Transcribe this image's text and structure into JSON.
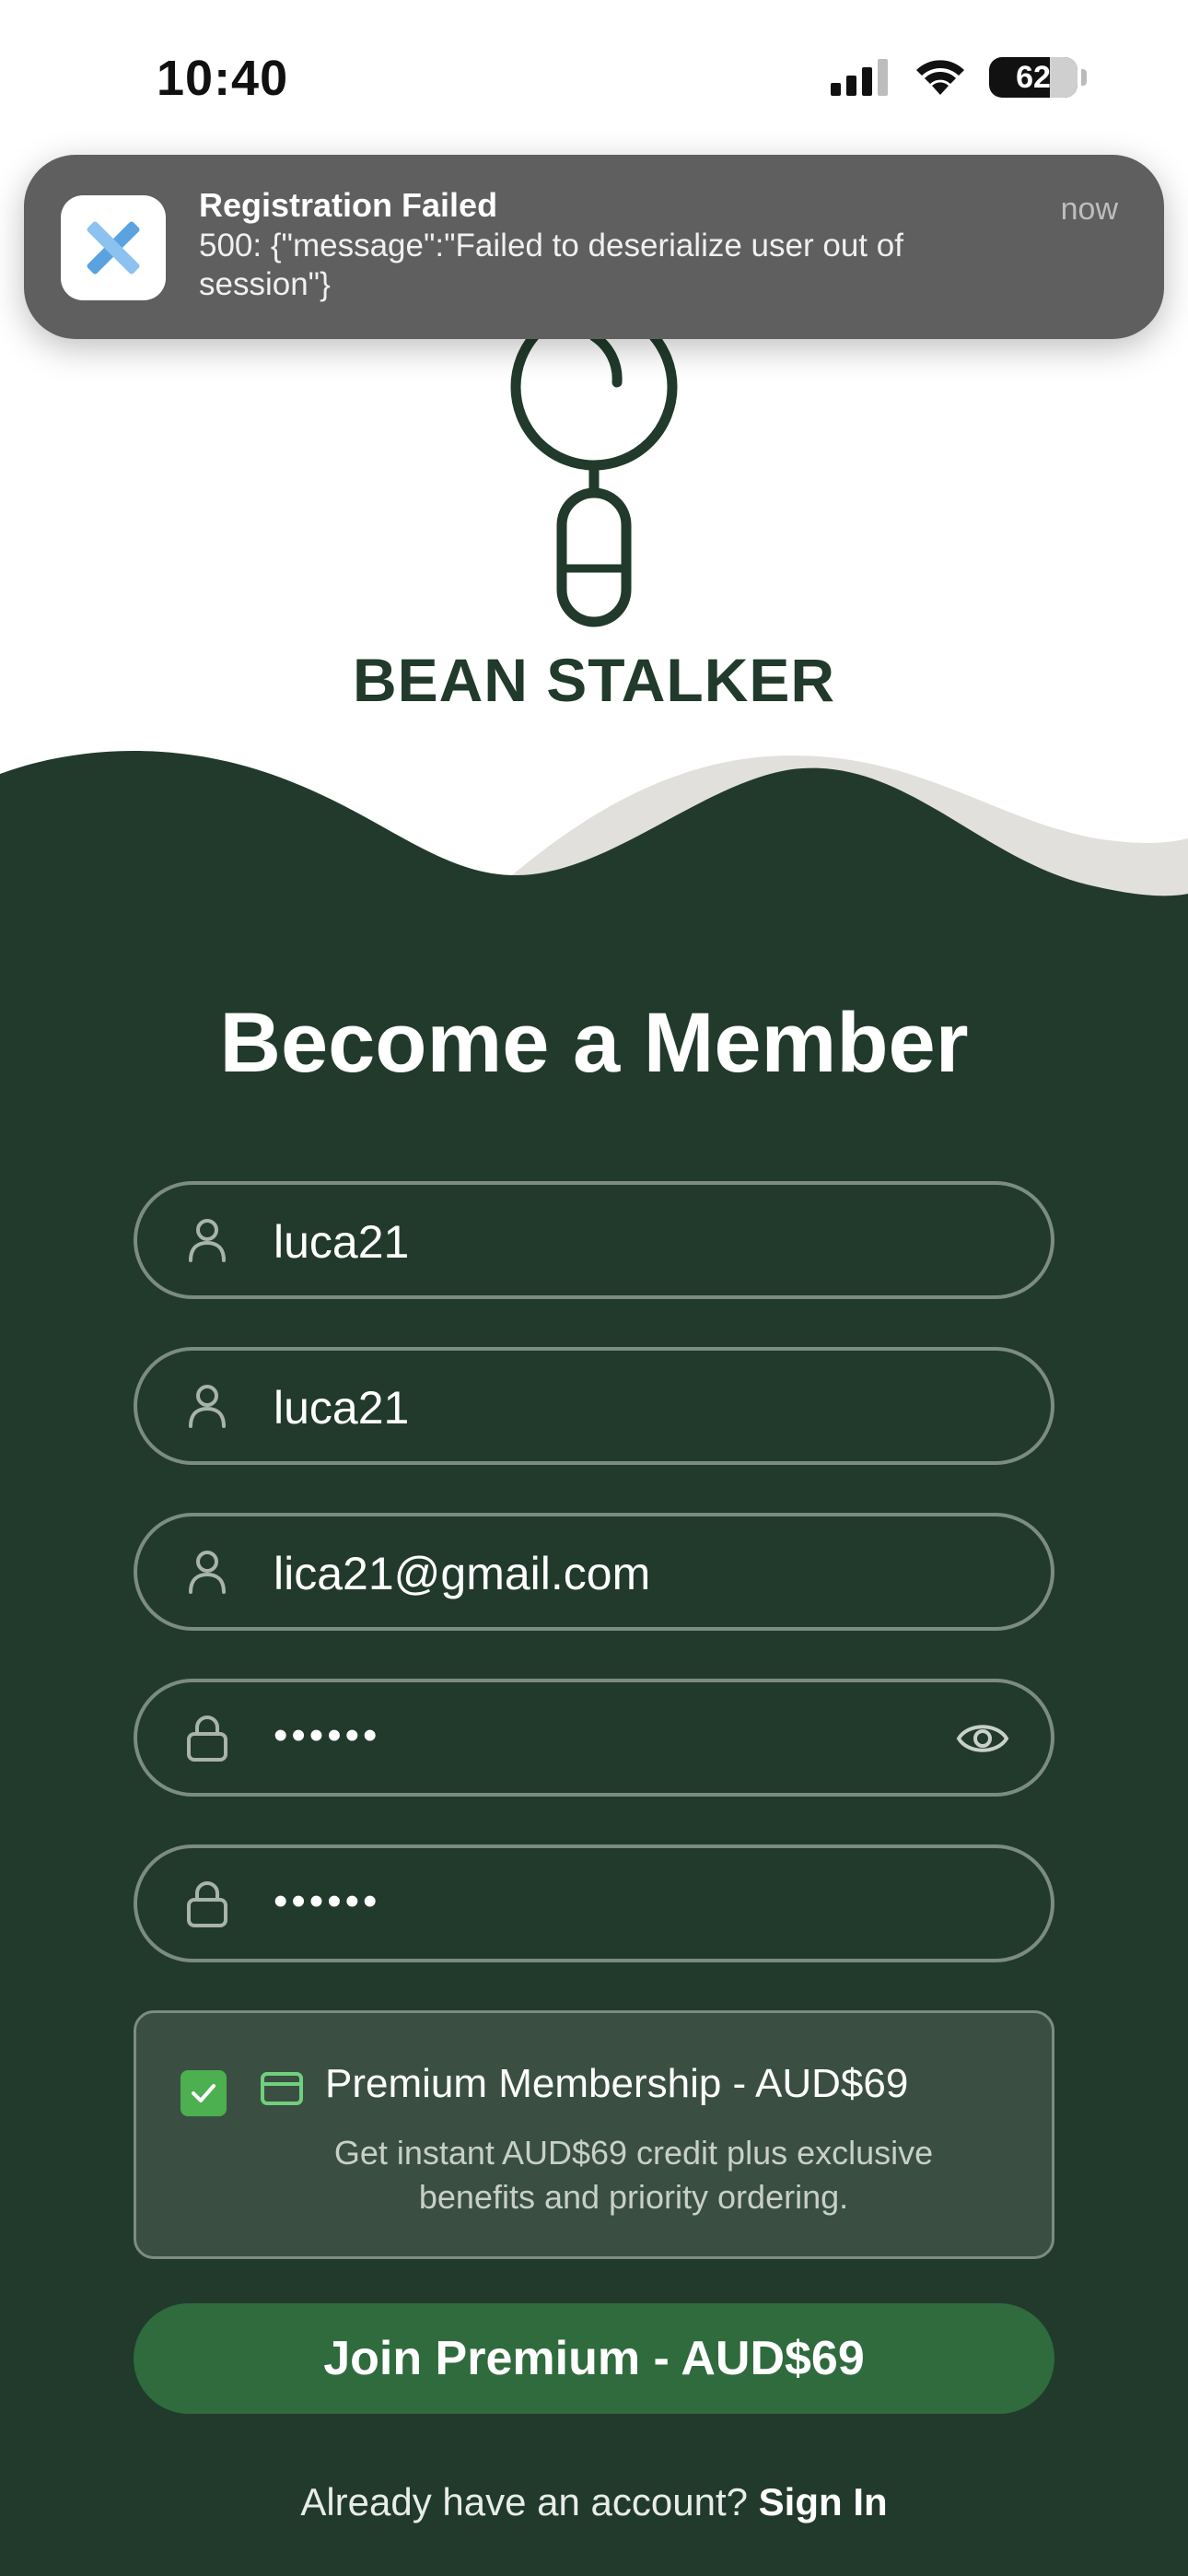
{
  "status_bar": {
    "time": "10:40",
    "battery": "62"
  },
  "notification": {
    "title": "Registration Failed",
    "body": "500: {\"message\":\"Failed to deserialize user out of session\"}",
    "time": "now"
  },
  "brand": {
    "name": "BEAN STALKER"
  },
  "form": {
    "heading": "Become a Member",
    "fields": [
      {
        "value": "luca21",
        "icon": "person-icon"
      },
      {
        "value": "luca21",
        "icon": "person-icon"
      },
      {
        "value": "lica21@gmail.com",
        "icon": "person-icon"
      },
      {
        "value": "••••••",
        "icon": "lock-icon",
        "trailing_icon": "eye-icon"
      },
      {
        "value": "••••••",
        "icon": "lock-icon"
      }
    ],
    "premium": {
      "checked": true,
      "title": "Premium Membership - AUD$69",
      "description": "Get instant AUD$69 credit plus exclusive benefits and priority ordering."
    },
    "submit_label": "Join Premium - AUD$69",
    "signin_prompt": "Already have an account?",
    "signin_link": "Sign In"
  },
  "colors": {
    "background_green": "#223a2c",
    "button_green": "#2f6b3d",
    "checkbox_green": "#4caf50",
    "brand_dark": "#213a2b"
  }
}
